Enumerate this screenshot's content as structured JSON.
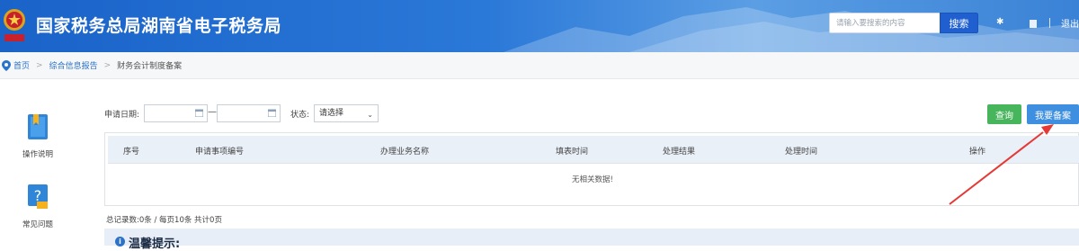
{
  "header": {
    "site_title": "国家税务总局湖南省电子税务局",
    "search_placeholder": "请输入要搜索的内容",
    "search_button": "搜索",
    "icon_1": "✱",
    "right_text": "退出",
    "brand_color": "#2a78d8"
  },
  "breadcrumb": {
    "items": [
      "首页",
      "综合信息报告",
      "财务会计制度备案"
    ],
    "separator": ">"
  },
  "sidebar": {
    "items": [
      {
        "label": "操作说明",
        "icon": "book-icon"
      },
      {
        "label": "常见问题",
        "icon": "question-icon"
      }
    ]
  },
  "filters": {
    "date_label": "申请日期:",
    "date_dash": "—",
    "status_label": "状态:",
    "status_value": "请选择"
  },
  "buttons": {
    "query": "查询",
    "file": "我要备案",
    "query_color": "#47b55b",
    "file_color": "#3f8fe0"
  },
  "table": {
    "columns": [
      "序号",
      "申请事项编号",
      "办理业务名称",
      "填表时间",
      "处理结果",
      "处理时间",
      "操作"
    ],
    "empty_text": "无相关数据!"
  },
  "summary": "总记录数:0条 / 每页10条 共计0页",
  "tips": {
    "title": "温馨提示:"
  },
  "annotation_color": "#e53935"
}
